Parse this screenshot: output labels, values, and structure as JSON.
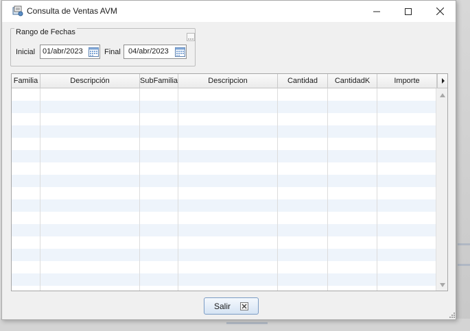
{
  "window": {
    "title": "Consulta de Ventas AVM"
  },
  "filters": {
    "group_label": "Rango de Fechas",
    "inicial_label": "Inicial",
    "inicial_value": "01/abr/2023",
    "final_label": "Final",
    "final_value": "04/abr/2023"
  },
  "table": {
    "columns": [
      "Familia",
      "Descripción",
      "SubFamilia",
      "Descripcion",
      "Cantidad",
      "CantidadK",
      "Importe"
    ],
    "rows": []
  },
  "actions": {
    "salir_label": "Salir"
  },
  "colors": {
    "row_alt": "#eef4fb",
    "button_border": "#7a9bc4"
  }
}
